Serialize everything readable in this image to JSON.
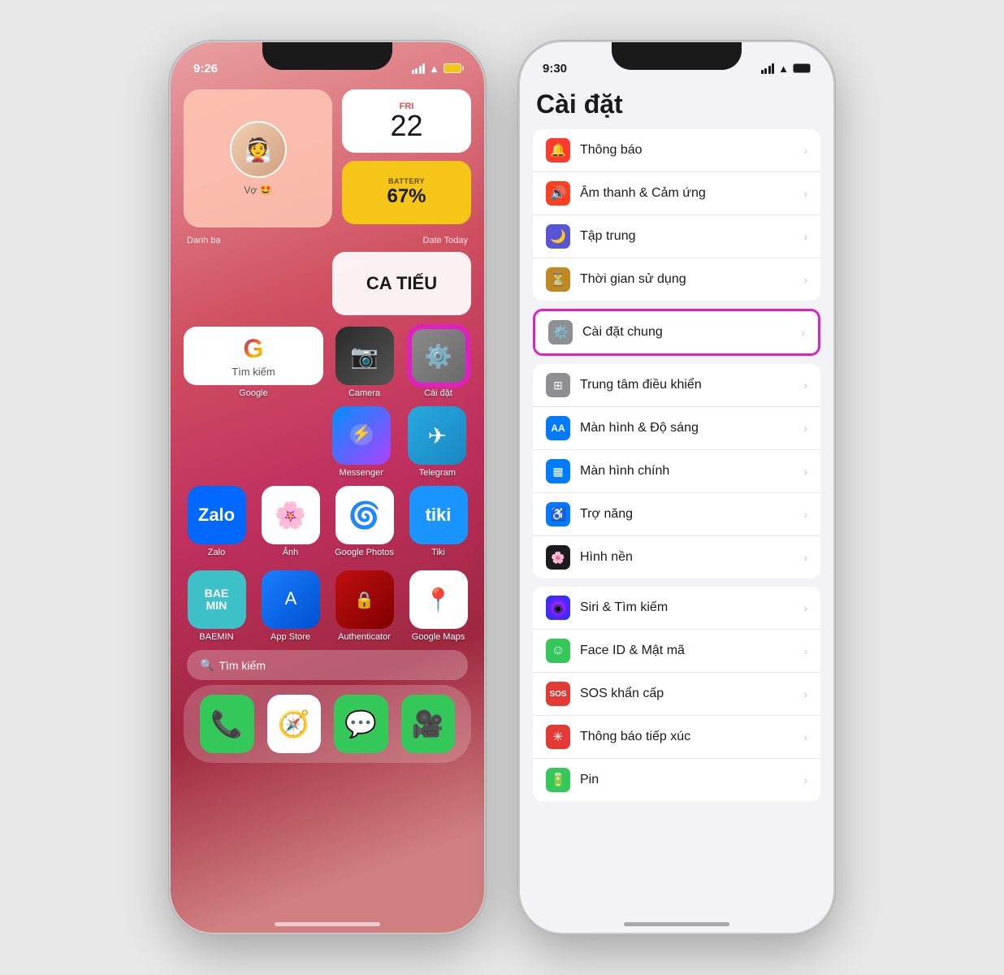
{
  "phone1": {
    "statusBar": {
      "time": "9:26",
      "battery": "yellow"
    },
    "widgets": {
      "contact": {
        "name": "Vợ 🤩",
        "label": "Danh bạ"
      },
      "date": {
        "dayName": "FRI",
        "dayNumber": "22",
        "label": "Date Today"
      },
      "battery": {
        "label": "BATTERY",
        "percent": "67%"
      },
      "catieo": {
        "text": "CA TIẾU"
      }
    },
    "appGrid": {
      "row1": [
        {
          "id": "google-search",
          "label": "Google",
          "icon": "G",
          "type": "google-widget",
          "span": 2
        },
        {
          "id": "camera",
          "label": "Camera",
          "icon": "📷",
          "type": "camera"
        },
        {
          "id": "settings",
          "label": "Cài đặt",
          "icon": "⚙️",
          "type": "settings",
          "highlighted": true
        }
      ],
      "row2": [
        {
          "id": "messenger",
          "label": "Messenger",
          "icon": "💬",
          "type": "messenger"
        },
        {
          "id": "telegram",
          "label": "Telegram",
          "icon": "✈️",
          "type": "telegram"
        }
      ],
      "row3": [
        {
          "id": "zalo",
          "label": "Zalo",
          "icon": "Z",
          "type": "zalo"
        },
        {
          "id": "photos",
          "label": "Ảnh",
          "icon": "🌸",
          "type": "photos"
        },
        {
          "id": "gphotos",
          "label": "Google Photos",
          "icon": "🌀",
          "type": "gphotos"
        },
        {
          "id": "tiki",
          "label": "Tiki",
          "icon": "T",
          "type": "tiki"
        }
      ],
      "row4": [
        {
          "id": "baemin",
          "label": "BAEMIN",
          "icon": "B",
          "type": "baemin"
        },
        {
          "id": "appstore",
          "label": "App Store",
          "icon": "A",
          "type": "appstore"
        },
        {
          "id": "authenticator",
          "label": "Authenticator",
          "icon": "🔐",
          "type": "authenticator"
        },
        {
          "id": "googlemaps",
          "label": "Google Maps",
          "icon": "📍",
          "type": "googlemaps"
        }
      ]
    },
    "searchBar": {
      "icon": "🔍",
      "placeholder": "Tìm kiếm"
    },
    "dock": [
      {
        "id": "phone",
        "icon": "📞",
        "color": "#34c759"
      },
      {
        "id": "safari",
        "icon": "🧭",
        "color": "white"
      },
      {
        "id": "messages",
        "icon": "💬",
        "color": "#34c759"
      },
      {
        "id": "facetime",
        "icon": "🎥",
        "color": "#34c759"
      }
    ]
  },
  "phone2": {
    "statusBar": {
      "time": "9:30"
    },
    "title": "Cài đặt",
    "settingsItems": [
      {
        "id": "notifications",
        "label": "Thông báo",
        "iconColor": "#ff3b30",
        "iconSymbol": "🔔"
      },
      {
        "id": "sound",
        "label": "Âm thanh & Cảm ứng",
        "iconColor": "#ff4020",
        "iconSymbol": "🔊"
      },
      {
        "id": "focus",
        "label": "Tập trung",
        "iconColor": "#5856d6",
        "iconSymbol": "🌙"
      },
      {
        "id": "screentime",
        "label": "Thời gian sử dụng",
        "iconColor": "#c08820",
        "iconSymbol": "⏳"
      },
      {
        "id": "general",
        "label": "Cài đặt chung",
        "iconColor": "#8e8e93",
        "iconSymbol": "⚙️",
        "highlighted": true
      },
      {
        "id": "controlcenter",
        "label": "Trung tâm điều khiển",
        "iconColor": "#8e8e93",
        "iconSymbol": "⊞"
      },
      {
        "id": "display",
        "label": "Màn hình & Độ sáng",
        "iconColor": "#007aff",
        "iconSymbol": "AA"
      },
      {
        "id": "homescreen",
        "label": "Màn hình chính",
        "iconColor": "#007aff",
        "iconSymbol": "▦"
      },
      {
        "id": "accessibility",
        "label": "Trợ năng",
        "iconColor": "#007aff",
        "iconSymbol": "♿"
      },
      {
        "id": "wallpaper",
        "label": "Hình nền",
        "iconColor": "#1c1c1e",
        "iconSymbol": "🌸"
      },
      {
        "id": "siri",
        "label": "Siri & Tìm kiếm",
        "iconColor": "#1c1c1e",
        "iconSymbol": "◉"
      },
      {
        "id": "faceid",
        "label": "Face ID & Mật mã",
        "iconColor": "#34c759",
        "iconSymbol": "☺"
      },
      {
        "id": "sos",
        "label": "SOS khẩn cấp",
        "iconColor": "#e53935",
        "iconSymbol": "SOS"
      },
      {
        "id": "exposurenotif",
        "label": "Thông báo tiếp xúc",
        "iconColor": "#e53935",
        "iconSymbol": "✳"
      },
      {
        "id": "battery",
        "label": "Pin",
        "iconColor": "#34c759",
        "iconSymbol": "🔋"
      }
    ]
  }
}
